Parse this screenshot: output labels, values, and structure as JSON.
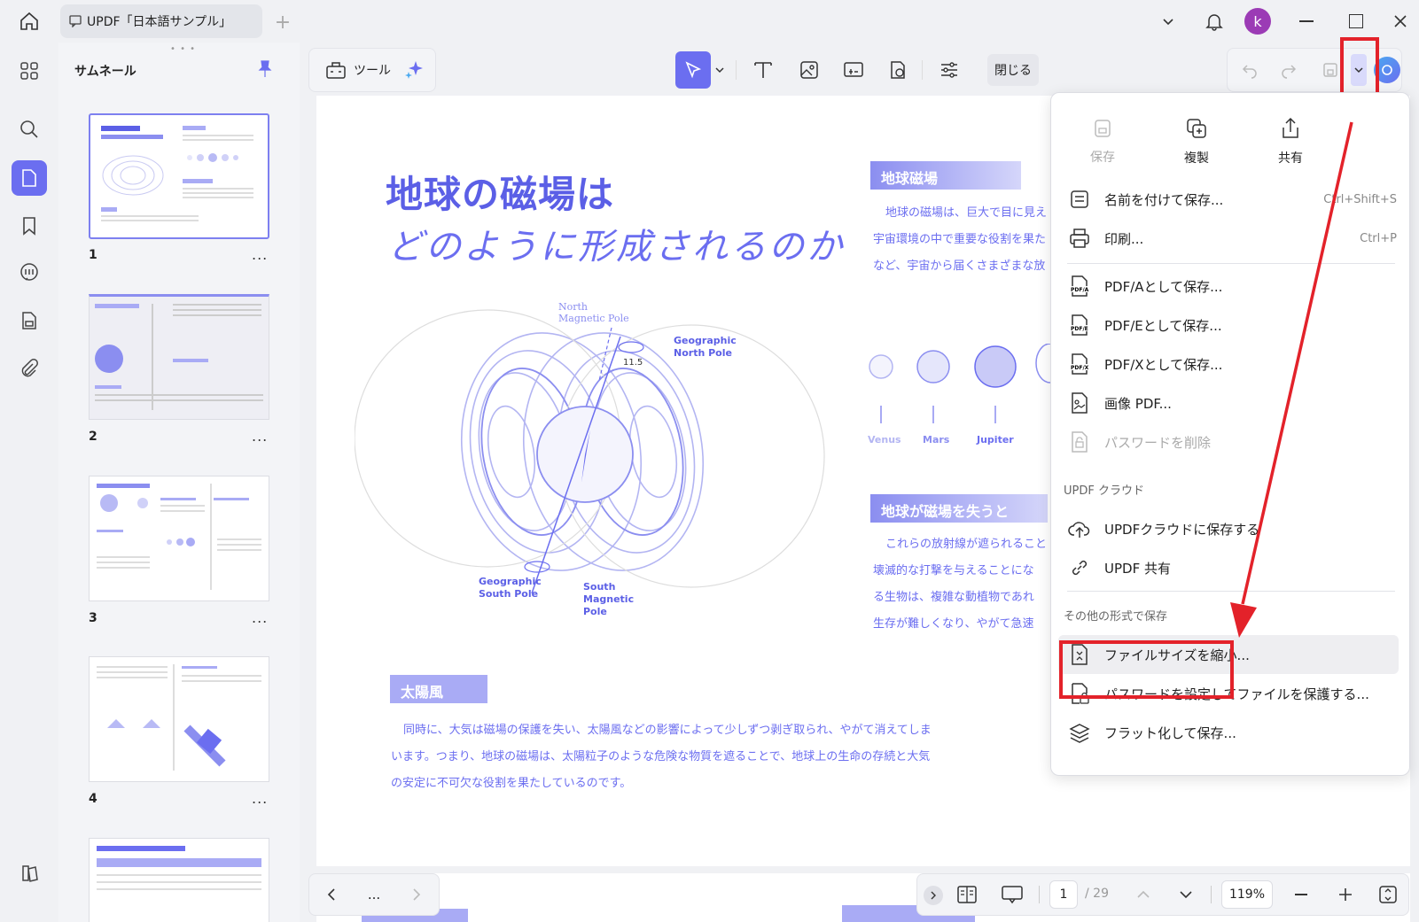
{
  "window": {
    "tab_title": "UPDF「日本語サンプル」",
    "avatar_letter": "k",
    "accent": "#6b6ef0",
    "highlight_red": "#e3222a"
  },
  "sidebar": {
    "panel_title": "サムネール",
    "thumbnails": [
      {
        "number": "1",
        "more": "..."
      },
      {
        "number": "2",
        "more": "..."
      },
      {
        "number": "3",
        "more": "..."
      },
      {
        "number": "4",
        "more": "..."
      }
    ]
  },
  "toolbar": {
    "tools_label": "ツール",
    "close_label": "閉じる"
  },
  "document": {
    "title_line1": "地球の磁場は",
    "title_line2": "どのように形成されるのか",
    "diagram_labels": {
      "north_magnetic_pole_1": "North",
      "north_magnetic_pole_2": "Magnetic Pole",
      "geographic_north_1": "Geographic",
      "geographic_north_2": "North Pole",
      "angle": "11.5",
      "geographic_south_1": "Geographic",
      "geographic_south_2": "South Pole",
      "south_magnetic_1": "South",
      "south_magnetic_2": "Magnetic",
      "south_magnetic_3": "Pole"
    },
    "section_earth_field": "地球磁場",
    "earth_field_lines": [
      "地球の磁場は、巨大で目に見え",
      "宇宙環境の中で重要な役割を果た",
      "など、宇宙から届くさまざまな放"
    ],
    "planets": [
      "Venus",
      "Mars",
      "Jupiter"
    ],
    "section_lose": "地球が磁場を失うと",
    "lose_lines": [
      "これらの放射線が遮られること",
      "壊滅的な打撃を与えることにな",
      "る生物は、複雑な動植物であれ",
      "生存が難しくなり、やがて急速"
    ],
    "section_solar_wind": "太陽風",
    "solar_lines": [
      "同時に、大気は磁場の保護を失い、太陽風などの影響によって少しずつ剥ぎ取られ、やがて消えてしま",
      "います。つまり、地球の磁場は、太陽粒子のような危険な物質を遮ることで、地球上の生命の存続と大気",
      "の安定に不可欠な役割を果たしているのです。"
    ]
  },
  "menu": {
    "top_actions": [
      {
        "label": "保存",
        "icon": "save-icon",
        "disabled": true
      },
      {
        "label": "複製",
        "icon": "duplicate-icon",
        "disabled": false
      },
      {
        "label": "共有",
        "icon": "share-icon",
        "disabled": false
      }
    ],
    "save_as": "名前を付けて保存...",
    "save_as_shortcut": "Ctrl+Shift+S",
    "print": "印刷...",
    "print_shortcut": "Ctrl+P",
    "pdfa": "PDF/Aとして保存...",
    "pdfe": "PDF/Eとして保存...",
    "pdfx": "PDF/Xとして保存...",
    "image_pdf": "画像 PDF...",
    "remove_password": "パスワードを削除",
    "cloud_section": "UPDF クラウド",
    "save_cloud": "UPDFクラウドに保存する",
    "updf_share": "UPDF 共有",
    "other_section": "その他の形式で保存",
    "reduce_size": "ファイルサイズを縮小...",
    "protect_password": "パスワードを設定してファイルを保護する...",
    "flatten": "フラット化して保存..."
  },
  "statusbar": {
    "page_more": "...",
    "current_page": "1",
    "total_pages": "/ 29",
    "zoom": "119%"
  }
}
